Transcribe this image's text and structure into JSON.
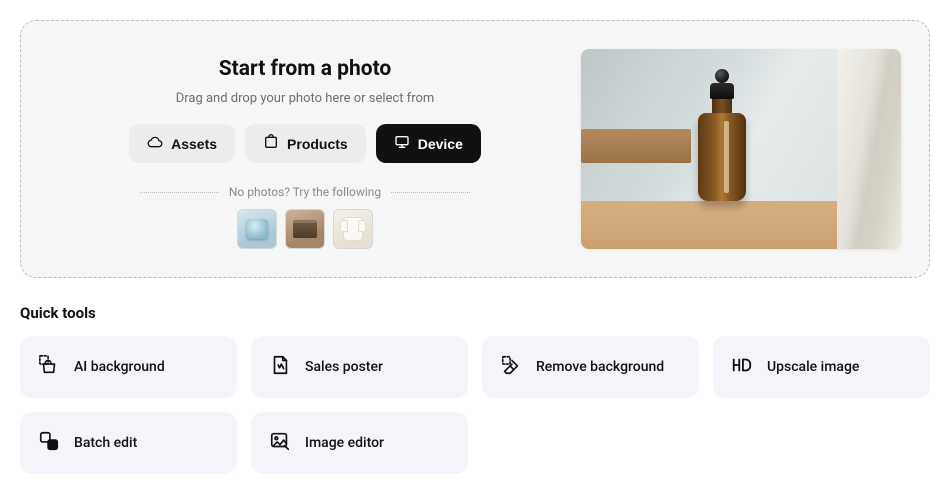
{
  "upload": {
    "title": "Start from a photo",
    "subtitle": "Drag and drop your photo here or select from",
    "sources": [
      {
        "key": "assets",
        "label": "Assets",
        "active": false
      },
      {
        "key": "products",
        "label": "Products",
        "active": false
      },
      {
        "key": "device",
        "label": "Device",
        "active": true
      }
    ],
    "try_label": "No photos? Try the following",
    "samples": [
      {
        "name": "sample-earbuds"
      },
      {
        "name": "sample-palette"
      },
      {
        "name": "sample-shirt"
      }
    ],
    "preview": {
      "name": "preview-bottle"
    }
  },
  "quick_tools": {
    "heading": "Quick tools",
    "items": [
      {
        "key": "ai-background",
        "label": "AI background"
      },
      {
        "key": "sales-poster",
        "label": "Sales poster"
      },
      {
        "key": "remove-background",
        "label": "Remove background"
      },
      {
        "key": "upscale-image",
        "label": "Upscale image"
      },
      {
        "key": "batch-edit",
        "label": "Batch edit"
      },
      {
        "key": "image-editor",
        "label": "Image editor"
      }
    ]
  }
}
